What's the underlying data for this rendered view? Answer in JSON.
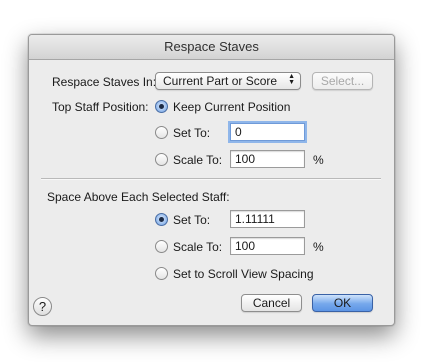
{
  "dialog": {
    "title": "Respace Staves",
    "respace_label": "Respace Staves In:",
    "respace_select_value": "Current Part or Score",
    "select_button_label": "Select...",
    "top_position_label": "Top Staff Position:",
    "top_options": {
      "keep_label": "Keep Current Position",
      "set_to_label": "Set To:",
      "set_to_value": "0",
      "scale_to_label": "Scale To:",
      "scale_to_value": "100",
      "percent": "%",
      "selected": "keep"
    },
    "space_above_label": "Space Above Each Selected Staff:",
    "space_options": {
      "set_to_label": "Set To:",
      "set_to_value": "1.11111",
      "scale_to_label": "Scale To:",
      "scale_to_value": "100",
      "percent": "%",
      "scroll_label": "Set to Scroll View Spacing",
      "selected": "set_to"
    },
    "help_label": "?",
    "cancel_label": "Cancel",
    "ok_label": "OK"
  }
}
